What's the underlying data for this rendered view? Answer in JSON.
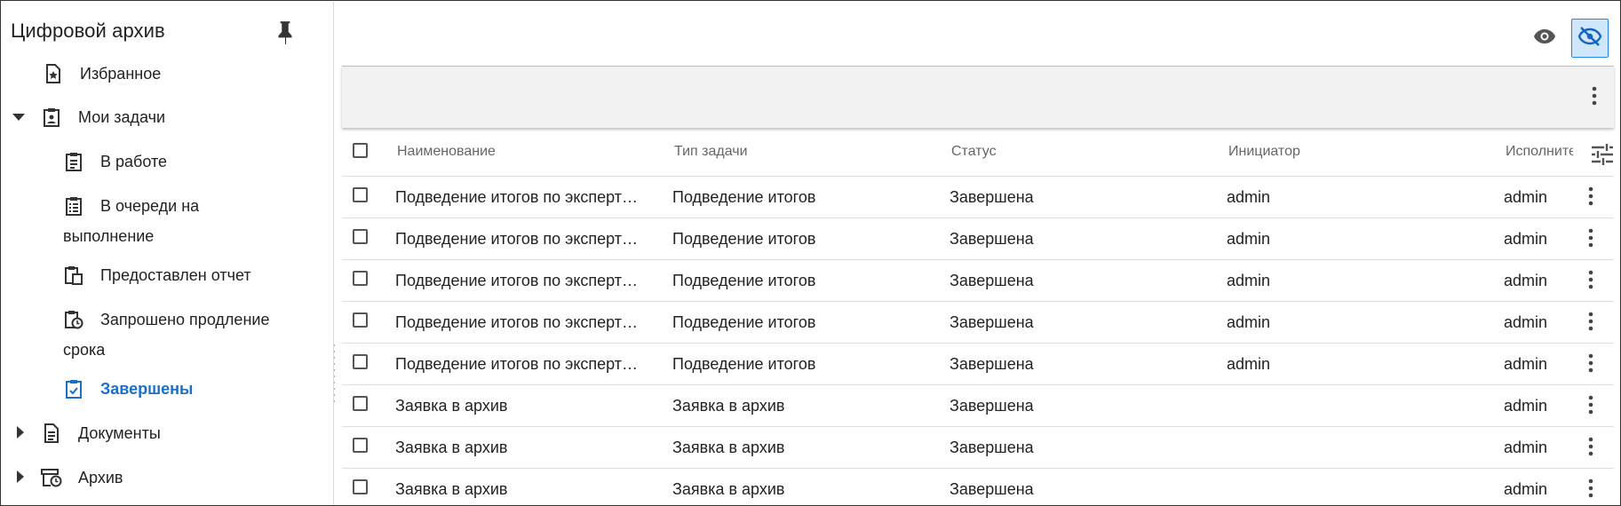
{
  "sidebar": {
    "title": "Цифровой архив",
    "items": [
      {
        "label": "Избранное"
      },
      {
        "label": "Мои задачи"
      },
      {
        "label": "В работе"
      },
      {
        "label": "В очереди на выполнение"
      },
      {
        "label": "Предоставлен отчет"
      },
      {
        "label": "Запрошено продление срока"
      },
      {
        "label": "Завершены"
      },
      {
        "label": "Документы"
      },
      {
        "label": "Архив"
      }
    ],
    "active_color": "#1b6fc9"
  },
  "table": {
    "columns": [
      "Наименование",
      "Тип задачи",
      "Статус",
      "Инициатор",
      "Исполнитель"
    ],
    "rows": [
      {
        "name": "Подведение итогов по экспертизе",
        "type": "Подведение итогов",
        "status": "Завершена",
        "initiator": "admin",
        "executor": "admin"
      },
      {
        "name": "Подведение итогов по экспертизе",
        "type": "Подведение итогов",
        "status": "Завершена",
        "initiator": "admin",
        "executor": "admin"
      },
      {
        "name": "Подведение итогов по экспертизе",
        "type": "Подведение итогов",
        "status": "Завершена",
        "initiator": "admin",
        "executor": "admin"
      },
      {
        "name": "Подведение итогов по экспертизе",
        "type": "Подведение итогов",
        "status": "Завершена",
        "initiator": "admin",
        "executor": "admin"
      },
      {
        "name": "Подведение итогов по экспертизе",
        "type": "Подведение итогов",
        "status": "Завершена",
        "initiator": "admin",
        "executor": "admin"
      },
      {
        "name": "Заявка в архив",
        "type": "Заявка в архив",
        "status": "Завершена",
        "initiator": "",
        "executor": "admin"
      },
      {
        "name": "Заявка в архив",
        "type": "Заявка в архив",
        "status": "Завершена",
        "initiator": "",
        "executor": "admin"
      },
      {
        "name": "Заявка в архив",
        "type": "Заявка в архив",
        "status": "Завершена",
        "initiator": "",
        "executor": "admin"
      }
    ]
  },
  "icons": {
    "pin": "pin-icon",
    "eye": "eye-icon",
    "eye_off": "eye-off-icon",
    "more": "more-vertical-icon",
    "settings": "tune-icon"
  },
  "colors": {
    "accent": "#1e88e5",
    "toggle_bg": "#cfe6fb",
    "toolbar_bg": "#f2f2f2"
  }
}
